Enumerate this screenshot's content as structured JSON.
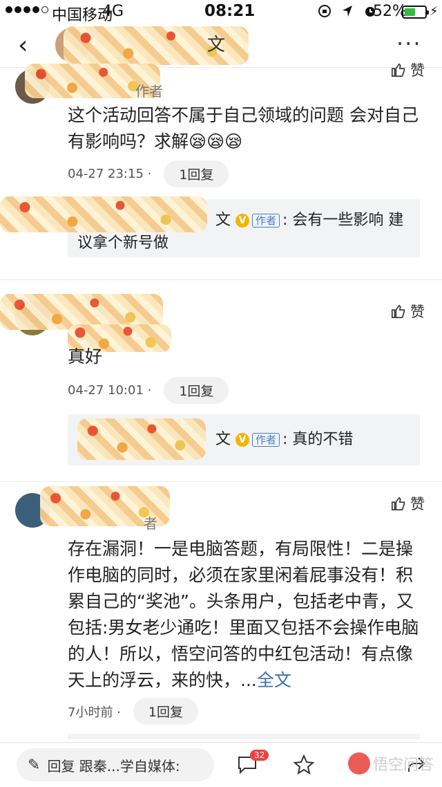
{
  "status_bar": {
    "carrier": "中国移动",
    "network": "4G",
    "time": "08:21",
    "battery": "52%",
    "battery_level": 0.52
  },
  "nav": {
    "back_icon": "chevron-left-icon",
    "title_fragment": "文",
    "more_label": "···"
  },
  "comments": [
    {
      "role": "作者",
      "like_label": "赞",
      "text": "这个活动回答不属于自己领域的问题 会对自己有影响吗？求解😪😪😪",
      "time": "04-27 23:15 ·",
      "reply_count": "1回复",
      "reply": {
        "tag": "作者",
        "text": ": 会有一些影响 建议拿个新号做",
        "name_fragment": "文"
      }
    },
    {
      "like_label": "赞",
      "text": "真好",
      "time": "04-27 10:01 ·",
      "reply_count": "1回复",
      "reply": {
        "tag": "作者",
        "text": ": 真的不错",
        "name_fragment": "文"
      }
    },
    {
      "role": "者",
      "like_label": "赞",
      "text": "存在漏洞！一是电脑答题，有局限性！二是操作电脑的同时，必须在家里闲着屁事没有！积累自己的“奖池”。头条用户，包括老中青，又包括:男女老少通吃！里面又包括不会操作电脑的人！所以，悟空问答的中红包活动！有点像天上的浮云，来的快，...",
      "full_text_link": "全文",
      "time": "7小时前 ·",
      "reply_count": "1回复"
    }
  ],
  "bottom_bar": {
    "reply_placeholder": "回复 跟秦...学自媒体:",
    "comment_count": "32",
    "watermark": "悟空问答"
  }
}
